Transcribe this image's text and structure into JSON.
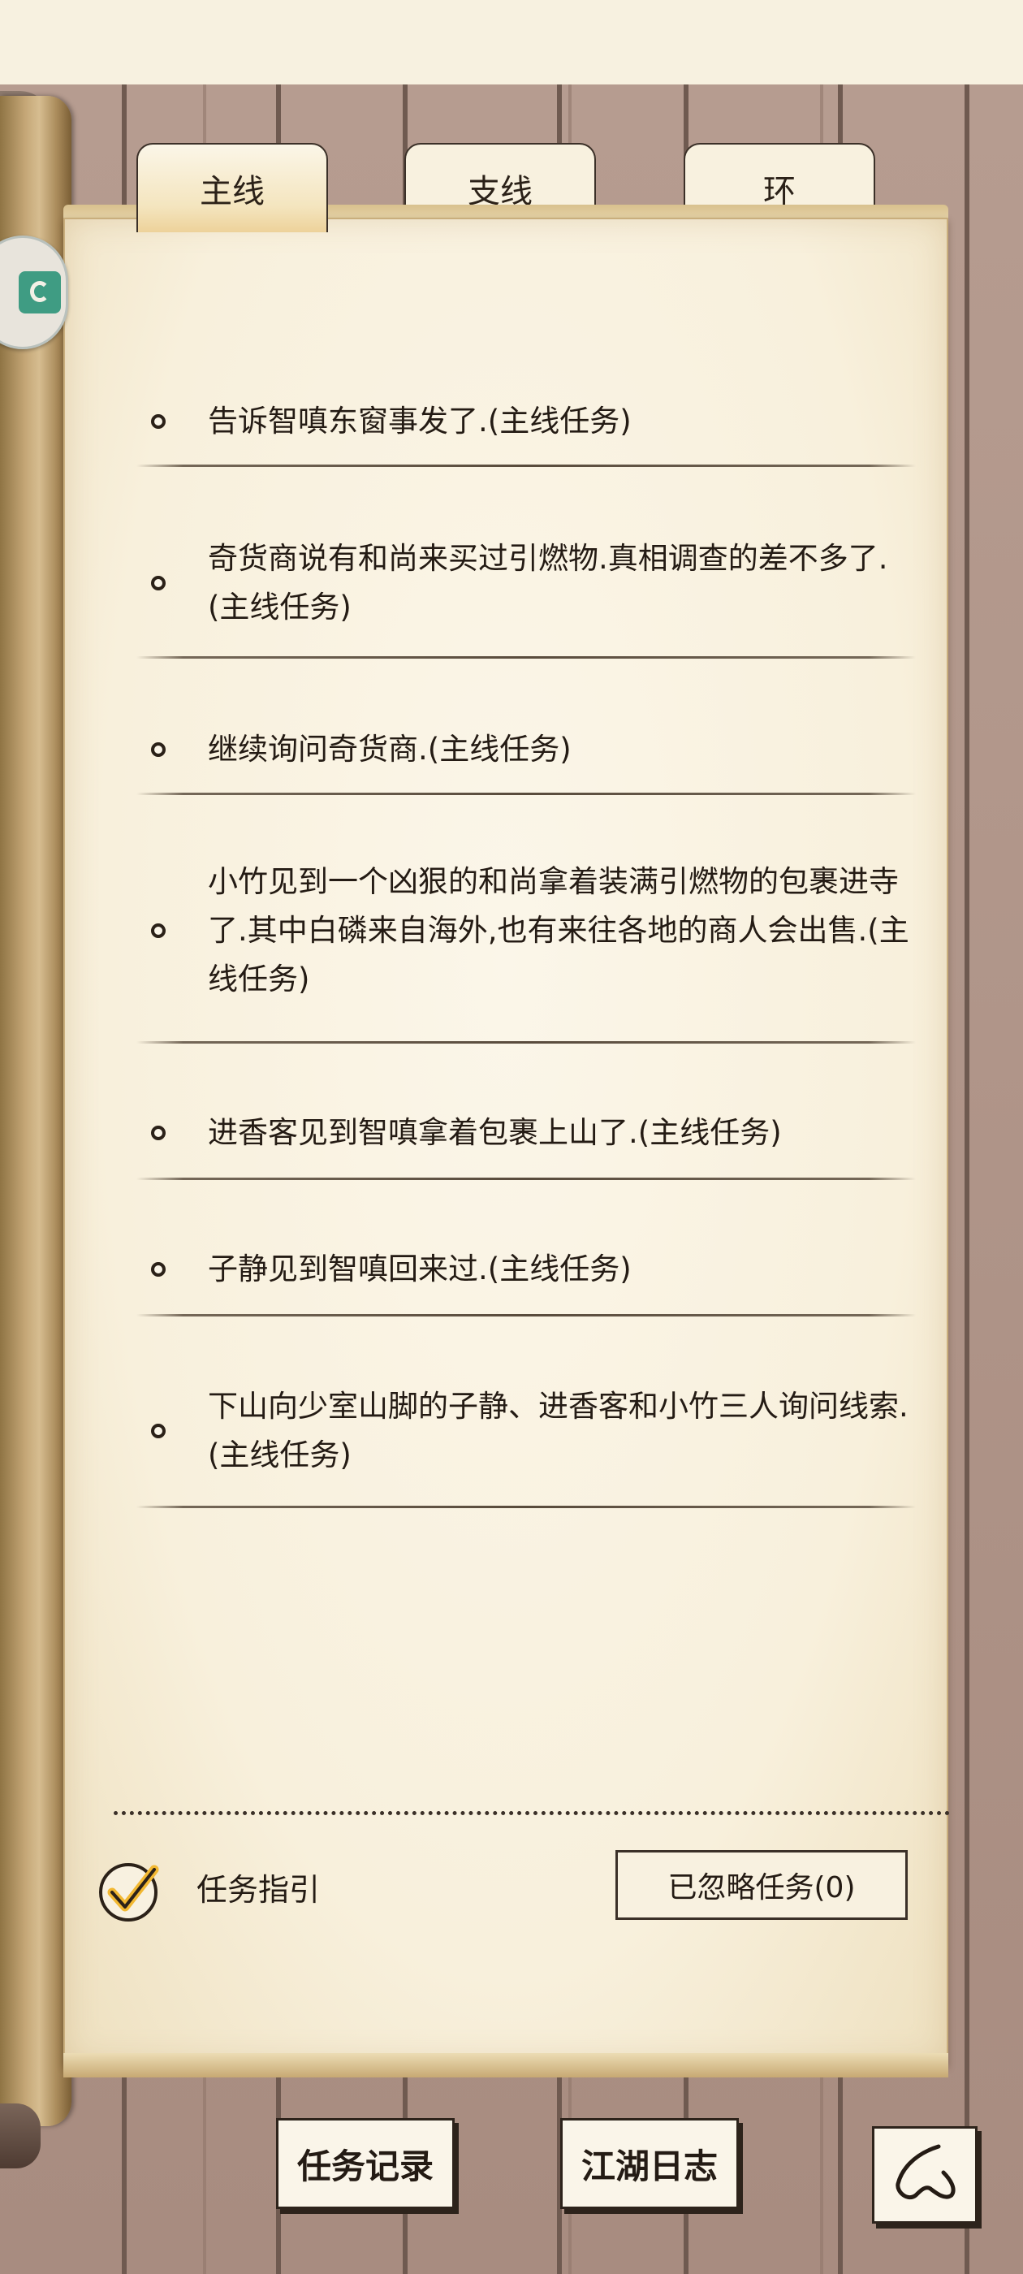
{
  "tabs": [
    {
      "label": "主线",
      "active": true
    },
    {
      "label": "支线",
      "active": false
    },
    {
      "label": "环",
      "active": false
    }
  ],
  "quests": [
    {
      "text": "告诉智嗔东窗事发了.(主线任务)"
    },
    {
      "text": "奇货商说有和尚来买过引燃物.真相调查的差不多了.(主线任务)"
    },
    {
      "text": "继续询问奇货商.(主线任务)"
    },
    {
      "text": "小竹见到一个凶狠的和尚拿着装满引燃物的包裹进寺了.其中白磷来自海外,也有来往各地的商人会出售.(主线任务)"
    },
    {
      "text": "进香客见到智嗔拿着包裹上山了.(主线任务)"
    },
    {
      "text": "子静见到智嗔回来过.(主线任务)"
    },
    {
      "text": "下山向少室山脚的子静、进香客和小竹三人询问线索.(主线任务)"
    }
  ],
  "guide": {
    "label": "任务指引",
    "checked": true
  },
  "ignored_button": {
    "label": "已忽略任务(0)"
  },
  "bottom_buttons": {
    "record": "任务记录",
    "journal": "江湖日志"
  },
  "icons": {
    "back": "back-arrow-icon",
    "side_badge": "map-icon",
    "check": "checkmark-icon"
  }
}
